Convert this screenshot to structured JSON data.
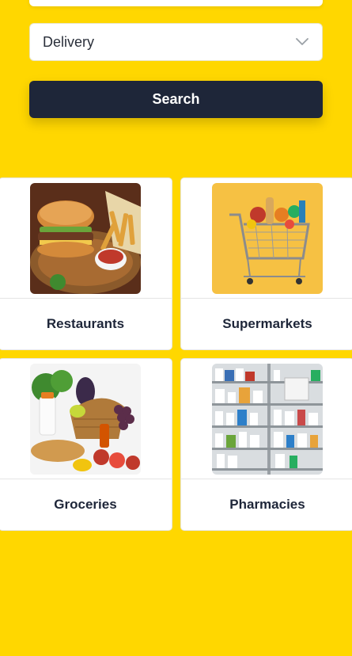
{
  "search": {
    "delivery_select": "Delivery",
    "search_label": "Search"
  },
  "categories": [
    {
      "label": "Restaurants"
    },
    {
      "label": "Supermarkets"
    },
    {
      "label": "Groceries"
    },
    {
      "label": "Pharmacies"
    }
  ],
  "colors": {
    "background": "#FFD700",
    "button": "#1E2639",
    "text": "#1E2639"
  }
}
